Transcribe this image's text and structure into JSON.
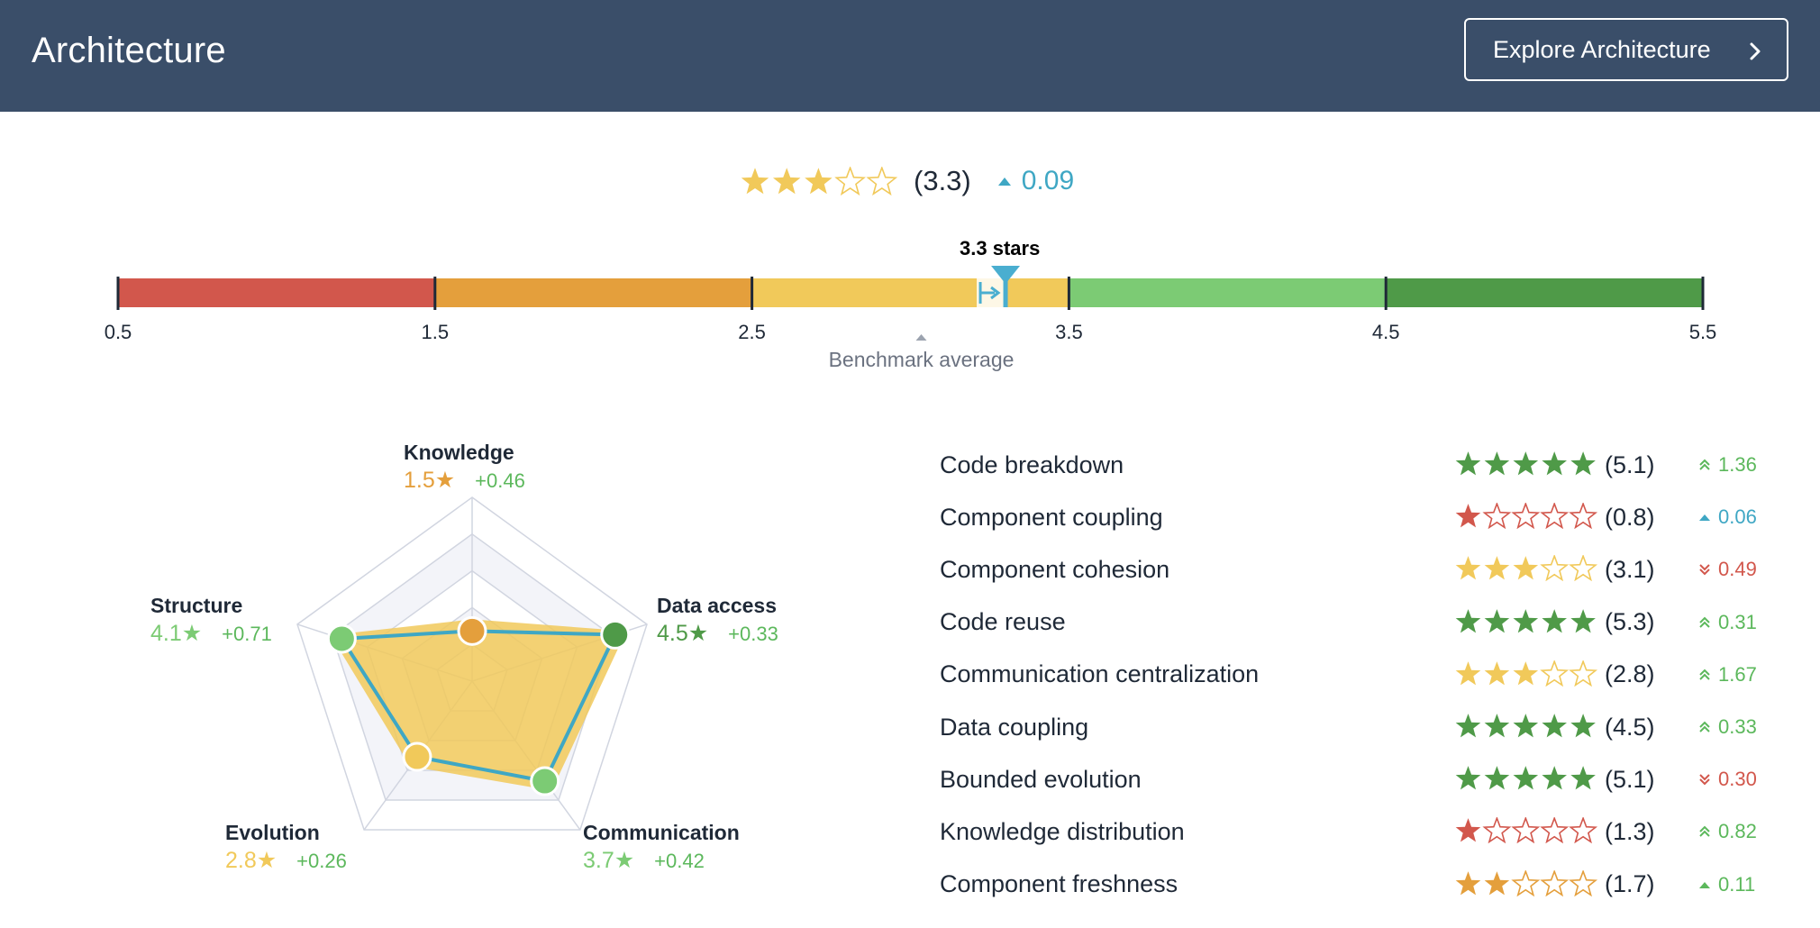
{
  "header": {
    "title": "Architecture",
    "explore_label": "Explore Architecture"
  },
  "overall": {
    "rating": 3.3,
    "score_text": "(3.3)",
    "delta_text": "0.09",
    "delta_direction": "up",
    "delta_color": "#3fa7c4"
  },
  "scale": {
    "marker_label": "3.3 stars",
    "marker_value": 3.3,
    "benchmark_value": 3.0,
    "benchmark_label": "Benchmark average",
    "ticks": [
      "0.5",
      "1.5",
      "2.5",
      "3.5",
      "4.5",
      "5.5"
    ],
    "segment_colors": [
      "#d2574c",
      "#e49f3c",
      "#f1c95a",
      "#7ccb74",
      "#4f9a48"
    ]
  },
  "radar": {
    "axes": [
      {
        "name": "Knowledge",
        "score_text": "1.5★",
        "delta_text": "+0.46",
        "value": 1.5,
        "color": "#e49f3c"
      },
      {
        "name": "Data access",
        "score_text": "4.5★",
        "delta_text": "+0.33",
        "value": 4.5,
        "color": "#4f9a48"
      },
      {
        "name": "Communication",
        "score_text": "3.7★",
        "delta_text": "+0.42",
        "value": 3.7,
        "color": "#7ccb74"
      },
      {
        "name": "Evolution",
        "score_text": "2.8★",
        "delta_text": "+0.26",
        "value": 2.8,
        "color": "#f1c95a"
      },
      {
        "name": "Structure",
        "score_text": "4.1★",
        "delta_text": "+0.71",
        "value": 4.1,
        "color": "#7ccb74"
      }
    ]
  },
  "metrics": [
    {
      "label": "Code breakdown",
      "rating": 5.1,
      "score_text": "(5.1)",
      "delta_text": "1.36",
      "icon": "double-chevron-up-icon",
      "star_color": "#4f9a48",
      "delta_color": "#5cb85c"
    },
    {
      "label": "Component coupling",
      "rating": 0.8,
      "score_text": "(0.8)",
      "delta_text": "0.06",
      "icon": "triangle-up-icon",
      "star_color": "#d2574c",
      "delta_color": "#3fa7c4"
    },
    {
      "label": "Component cohesion",
      "rating": 3.1,
      "score_text": "(3.1)",
      "delta_text": "0.49",
      "icon": "double-chevron-down-icon",
      "star_color": "#f1c95a",
      "delta_color": "#d2574c"
    },
    {
      "label": "Code reuse",
      "rating": 5.3,
      "score_text": "(5.3)",
      "delta_text": "0.31",
      "icon": "double-chevron-up-icon",
      "star_color": "#4f9a48",
      "delta_color": "#5cb85c"
    },
    {
      "label": "Communication centralization",
      "rating": 2.8,
      "score_text": "(2.8)",
      "delta_text": "1.67",
      "icon": "double-chevron-up-icon",
      "star_color": "#f1c95a",
      "delta_color": "#5cb85c"
    },
    {
      "label": "Data coupling",
      "rating": 4.5,
      "score_text": "(4.5)",
      "delta_text": "0.33",
      "icon": "double-chevron-up-icon",
      "star_color": "#4f9a48",
      "delta_color": "#5cb85c"
    },
    {
      "label": "Bounded evolution",
      "rating": 5.1,
      "score_text": "(5.1)",
      "delta_text": "0.30",
      "icon": "double-chevron-down-icon",
      "star_color": "#4f9a48",
      "delta_color": "#d2574c"
    },
    {
      "label": "Knowledge distribution",
      "rating": 1.3,
      "score_text": "(1.3)",
      "delta_text": "0.82",
      "icon": "double-chevron-up-icon",
      "star_color": "#d2574c",
      "delta_color": "#5cb85c"
    },
    {
      "label": "Component freshness",
      "rating": 1.7,
      "score_text": "(1.7)",
      "delta_text": "0.11",
      "icon": "triangle-up-icon",
      "star_color": "#e49f3c",
      "delta_color": "#5cb85c"
    }
  ]
}
